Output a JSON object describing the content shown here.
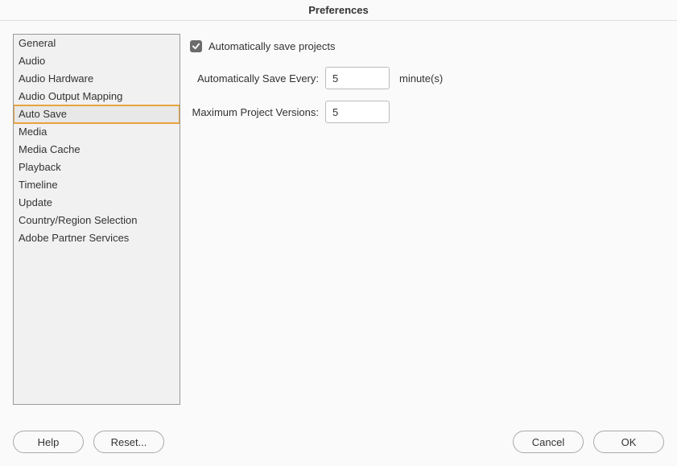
{
  "title": "Preferences",
  "sidebar": {
    "items": [
      {
        "label": "General"
      },
      {
        "label": "Audio"
      },
      {
        "label": "Audio Hardware"
      },
      {
        "label": "Audio Output Mapping"
      },
      {
        "label": "Auto Save"
      },
      {
        "label": "Media"
      },
      {
        "label": "Media Cache"
      },
      {
        "label": "Playback"
      },
      {
        "label": "Timeline"
      },
      {
        "label": "Update"
      },
      {
        "label": "Country/Region Selection"
      },
      {
        "label": "Adobe Partner Services"
      }
    ],
    "selected_index": 4
  },
  "pane": {
    "autosave_checkbox_label": "Automatically save projects",
    "autosave_checked": true,
    "interval_label": "Automatically Save Every:",
    "interval_value": "5",
    "interval_unit": "minute(s)",
    "versions_label": "Maximum Project Versions:",
    "versions_value": "5"
  },
  "footer": {
    "help": "Help",
    "reset": "Reset...",
    "cancel": "Cancel",
    "ok": "OK"
  }
}
